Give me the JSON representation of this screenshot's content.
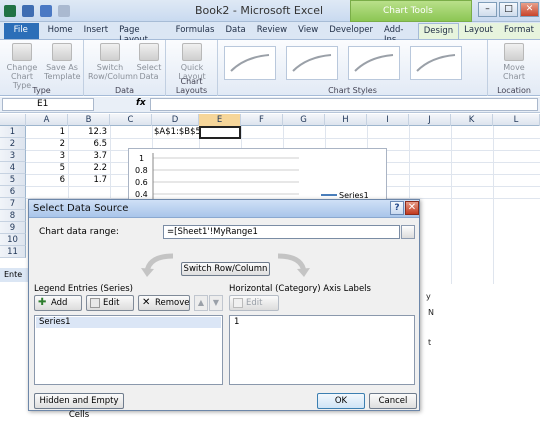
{
  "app": {
    "title": "Book2 - Microsoft Excel",
    "context_group": "Chart Tools"
  },
  "window_controls": {
    "minimize": "–",
    "maximize": "□",
    "close": "✕"
  },
  "tabs": [
    "File",
    "Home",
    "Insert",
    "Page Layout",
    "Formulas",
    "Data",
    "Review",
    "View",
    "Developer",
    "Add-Ins",
    "Design",
    "Layout",
    "Format"
  ],
  "ribbon": {
    "type_group": {
      "label": "Type",
      "change_chart_type": "Change Chart Type",
      "save_as_template": "Save As Template"
    },
    "data_group": {
      "label": "Data",
      "switch_row_column": "Switch Row/Column",
      "select_data": "Select Data"
    },
    "layouts_group": {
      "label": "Chart Layouts",
      "quick_layout": "Quick Layout"
    },
    "styles_group": {
      "label": "Chart Styles"
    },
    "location_group": {
      "label": "Location",
      "move_chart": "Move Chart"
    }
  },
  "formula_bar": {
    "name_box": "E1",
    "fx": "fx",
    "content": ""
  },
  "columns": [
    "A",
    "B",
    "C",
    "D",
    "E",
    "F",
    "G",
    "H",
    "I",
    "J",
    "K",
    "L"
  ],
  "rows": [
    "1",
    "2",
    "3",
    "4",
    "5",
    "6",
    "7",
    "8",
    "9",
    "10",
    "11"
  ],
  "cells": {
    "A": [
      "1",
      "2",
      "3",
      "5",
      "6"
    ],
    "B": [
      "12.3",
      "6.5",
      "3.7",
      "2.2",
      "1.7"
    ],
    "D1": "$A$1:$B$5"
  },
  "chart": {
    "y_ticks": [
      "1",
      "0.8",
      "0.6",
      "0.4"
    ],
    "legend": "Series1"
  },
  "status_bar": {
    "text": "Ente"
  },
  "dialog": {
    "title": "Select Data Source",
    "help": "?",
    "close": "✕",
    "range_label": "Chart data range:",
    "range_value": "=[Sheet1'!MyRange1",
    "switch_label": "Switch Row/Column",
    "legend_label": "Legend Entries (Series)",
    "add": "Add",
    "edit": "Edit",
    "remove": "Remove",
    "up": "▲",
    "down": "▼",
    "series": [
      "Series1"
    ],
    "axis_label": "Horizontal (Category) Axis Labels",
    "axis_edit": "Edit",
    "axis_values": [
      "1"
    ],
    "hidden_cells": "Hidden and Empty Cells",
    "ok": "OK",
    "cancel": "Cancel"
  },
  "side_text": [
    "y",
    "N",
    "t"
  ]
}
